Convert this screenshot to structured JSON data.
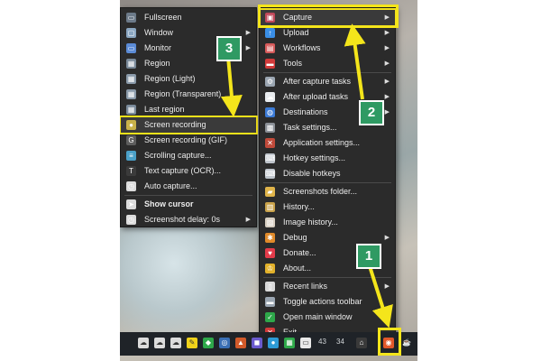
{
  "menu_left": [
    {
      "label": "Fullscreen",
      "icon": "monitor-icon",
      "color": "#6c7a89",
      "arrow": false
    },
    {
      "label": "Window",
      "icon": "window-icon",
      "color": "#8aa6c1",
      "arrow": true
    },
    {
      "label": "Monitor",
      "icon": "monitor-icon",
      "color": "#5b8bd6",
      "arrow": true
    },
    {
      "label": "Region",
      "icon": "region-icon",
      "color": "#7a8a9a",
      "arrow": false
    },
    {
      "label": "Region (Light)",
      "icon": "region-icon",
      "color": "#8a9aaa",
      "arrow": false
    },
    {
      "label": "Region (Transparent)",
      "icon": "region-icon",
      "color": "#8a9aaa",
      "arrow": false
    },
    {
      "label": "Last region",
      "icon": "region-icon",
      "color": "#7a8a9a",
      "arrow": false
    },
    {
      "label": "Screen recording",
      "icon": "camera-icon",
      "color": "#c8b24a",
      "arrow": false
    },
    {
      "label": "Screen recording (GIF)",
      "icon": "gif-icon",
      "color": "#5d5d5d",
      "arrow": false
    },
    {
      "label": "Scrolling capture...",
      "icon": "scroll-icon",
      "color": "#4aa0c8",
      "arrow": false
    },
    {
      "label": "Text capture (OCR)...",
      "icon": "text-icon",
      "color": "#3b3b3b",
      "arrow": false
    },
    {
      "label": "Auto capture...",
      "icon": "clock-icon",
      "color": "#dcdcdc",
      "arrow": false
    },
    {
      "label": "Show cursor",
      "icon": "cursor-icon",
      "color": "#dcdcdc",
      "arrow": false
    },
    {
      "label": "Screenshot delay: 0s",
      "icon": "clock-icon",
      "color": "#dcdcdc",
      "arrow": true
    }
  ],
  "menu_right": [
    {
      "label": "Capture",
      "icon": "capture-icon",
      "color": "#c0485a",
      "arrow": true
    },
    {
      "label": "Upload",
      "icon": "upload-arrow-icon",
      "color": "#3a8ee6",
      "arrow": true
    },
    {
      "label": "Workflows",
      "icon": "workflows-icon",
      "color": "#d65a5a",
      "arrow": true
    },
    {
      "label": "Tools",
      "icon": "toolbox-icon",
      "color": "#d23a3a",
      "arrow": true
    },
    {
      "label": "After capture tasks",
      "icon": "gear-icon",
      "color": "#9aa5b1",
      "arrow": true
    },
    {
      "label": "After upload tasks",
      "icon": "cloud-icon",
      "color": "#e9ecef",
      "arrow": true
    },
    {
      "label": "Destinations",
      "icon": "globe-icon",
      "color": "#3c7bd6",
      "arrow": true
    },
    {
      "label": "Task settings...",
      "icon": "settings-icon",
      "color": "#8a8f96",
      "arrow": false
    },
    {
      "label": "Application settings...",
      "icon": "tools-icon",
      "color": "#c04a3a",
      "arrow": false
    },
    {
      "label": "Hotkey settings...",
      "icon": "keyboard-icon",
      "color": "#bfc5cc",
      "arrow": false
    },
    {
      "label": "Disable hotkeys",
      "icon": "keyboard-icon",
      "color": "#bfc5cc",
      "arrow": false
    },
    {
      "label": "Screenshots folder...",
      "icon": "folder-icon",
      "color": "#e0b44a",
      "arrow": false
    },
    {
      "label": "History...",
      "icon": "history-icon",
      "color": "#c9a24a",
      "arrow": false
    },
    {
      "label": "Image history...",
      "icon": "image-icon",
      "color": "#d8cfc2",
      "arrow": false
    },
    {
      "label": "Debug",
      "icon": "bug-icon",
      "color": "#e08a2a",
      "arrow": true
    },
    {
      "label": "Donate...",
      "icon": "heart-icon",
      "color": "#e23b4a",
      "arrow": false
    },
    {
      "label": "About...",
      "icon": "crown-icon",
      "color": "#e2b12a",
      "arrow": false
    },
    {
      "label": "Recent links",
      "icon": "clipboard-icon",
      "color": "#d9d9d9",
      "arrow": true
    },
    {
      "label": "Toggle actions toolbar",
      "icon": "toolbar-icon",
      "color": "#9aa5b1",
      "arrow": false
    },
    {
      "label": "Open main window",
      "icon": "check-icon",
      "color": "#2ea84a",
      "arrow": false
    },
    {
      "label": "Exit",
      "icon": "close-icon",
      "color": "#d23a3a",
      "arrow": false
    }
  ],
  "badges": {
    "one": "1",
    "two": "2",
    "three": "3"
  },
  "taskbar": {
    "num_a": "43",
    "num_b": "34"
  }
}
